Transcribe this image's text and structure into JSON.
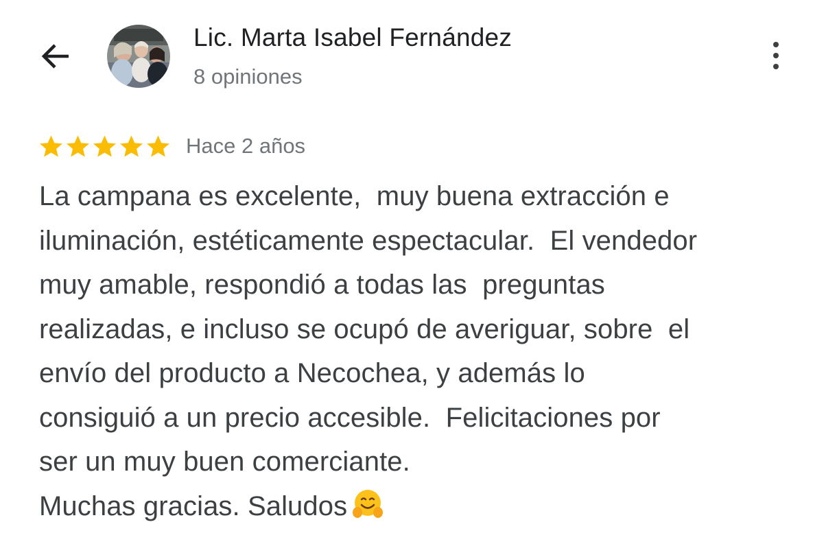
{
  "header": {
    "back_icon": "arrow-left-icon",
    "reviewer_name": "Lic. Marta Isabel Fernández",
    "review_count": "8 opiniones",
    "more_icon": "more-vertical-icon"
  },
  "review": {
    "rating": 5,
    "rating_max": 5,
    "star_color": "#fbbc04",
    "date": "Hace 2 años",
    "lines": [
      "La campana es excelente,  muy buena extracción e",
      "iluminación, estéticamente espectacular.  El vendedor",
      "muy amable, respondió a todas las  preguntas",
      "realizadas, e incluso se ocupó de averiguar, sobre  el",
      "envío del producto a Necochea, y además lo",
      "consiguió a un precio accesible.  Felicitaciones por",
      "ser un muy buen comerciante.",
      "Muchas gracias. Saludos"
    ],
    "emoji_icon": "hugging-face-emoji-icon"
  }
}
